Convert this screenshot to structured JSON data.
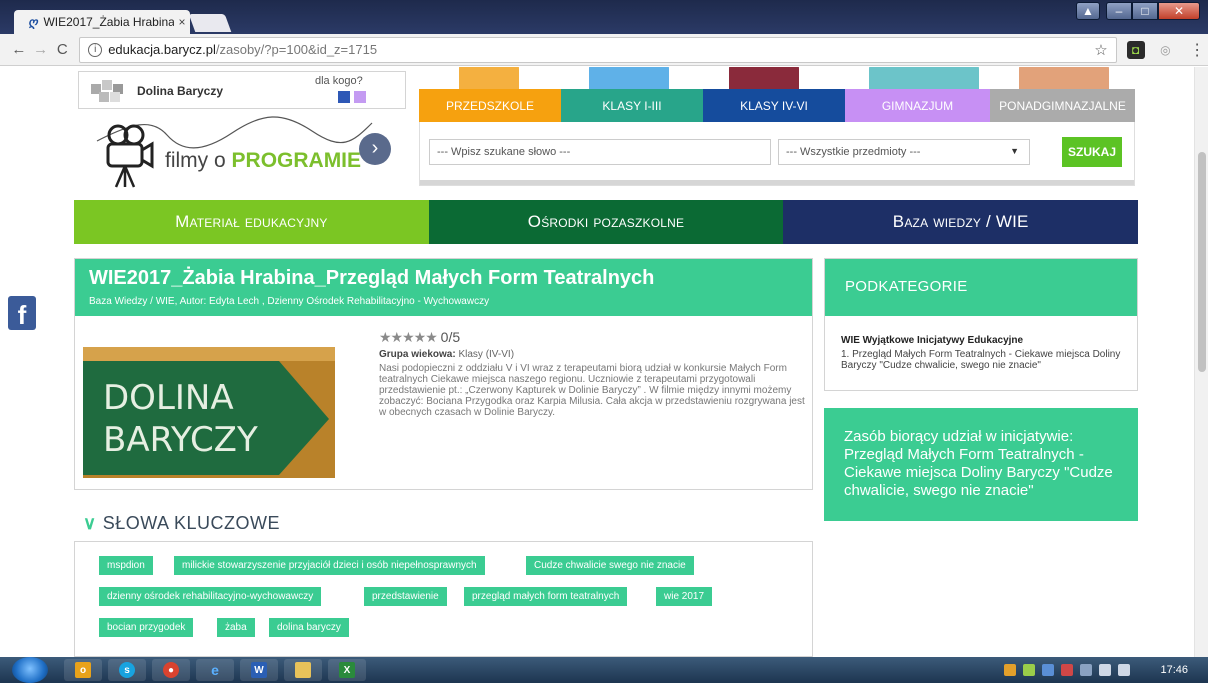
{
  "browser": {
    "tab_title": "WIE2017_Żabia Hrabina_",
    "tab_close": "×",
    "url_host": "edukacja.barycz.pl",
    "url_path": "/zasoby/?p=100&id_z=1715"
  },
  "header": {
    "logo_name": "Dolina Baryczy",
    "dla_kogo": "dla kogo?",
    "filmy_prefix": "filmy o ",
    "filmy_bold": "PROGRAMIE",
    "levels": [
      {
        "label": "PRZEDSZKOLE",
        "color": "#f6a10f"
      },
      {
        "label": "KLASY I-III",
        "color": "#28a58a"
      },
      {
        "label": "KLASY IV-VI",
        "color": "#154c9d"
      },
      {
        "label": "GIMNAZJUM",
        "color": "#c790f4"
      },
      {
        "label": "PONADGIMNAZJALNE",
        "color": "#ababab"
      }
    ],
    "search_placeholder": "--- Wpisz szukane słowo ---",
    "subject_select": "--- Wszystkie przedmioty ---",
    "search_button": "SZUKAJ"
  },
  "mainnav": [
    {
      "label": "Materiał edukacyjny",
      "color": "#7bc623"
    },
    {
      "label": "Ośrodki pozaszkolne",
      "color": "#0b6a34"
    },
    {
      "label": "Baza wiedzy / WIE",
      "color": "#1d2f66"
    }
  ],
  "article": {
    "title": "WIE2017_Żabia Hrabina_Przegląd Małych Form Teatralnych",
    "meta": "Baza Wiedzy / WIE, Autor: Edyta Lech , Dzienny Ośrodek Rehabilitacyjno - Wychowawczy",
    "stars": "★★★★★",
    "rating": "0/5",
    "age_label": "Grupa wiekowa:",
    "age_value": "Klasy (IV-VI)",
    "description": "Nasi podopieczni z oddziału V i VI wraz z terapeutami biorą udział w konkursie Małych Form teatralnych Ciekawe miejsca naszego regionu. Uczniowie z terapeutami przygotowali przedstawienie pt.: „Czerwony Kapturek w Dolinie Baryczy” . W filmie między innymi możemy zobaczyć: Bociana Przygodka oraz Karpia Milusia. Cała akcja w przedstawieniu rozgrywana jest w obecnych czasach w Dolinie Baryczy.",
    "image_text_1": "DOLINA",
    "image_text_2": "BARYCZY"
  },
  "keywords": {
    "title": "SŁOWA KLUCZOWE",
    "items": [
      "mspdion",
      "milickie stowarzyszenie przyjaciół dzieci i osób niepełnosprawnych",
      "Cudze chwalicie swego nie znacie",
      "dzienny ośrodek rehabilitacyjno-wychowawczy",
      "przedstawienie",
      "przegląd małych form teatralnych",
      "wie 2017",
      "bocian przygodek",
      "żaba",
      "dolina baryczy"
    ]
  },
  "sidebar": {
    "subcat_title": "PODKATEGORIE",
    "subcat_group": "WIE Wyjątkowe Inicjatywy Edukacyjne",
    "subcat_item": "1. Przegląd Małych Form Teatralnych - Ciekawe miejsca Doliny Baryczy \"Cudze chwalicie, swego nie znacie\"",
    "initiative": "Zasób biorący udział w inicjatywie: Przegląd Małych Form Teatralnych - Ciekawe miejsca Doliny Baryczy \"Cudze chwalicie, swego nie znacie\""
  },
  "taskbar": {
    "clock": "17:46"
  }
}
